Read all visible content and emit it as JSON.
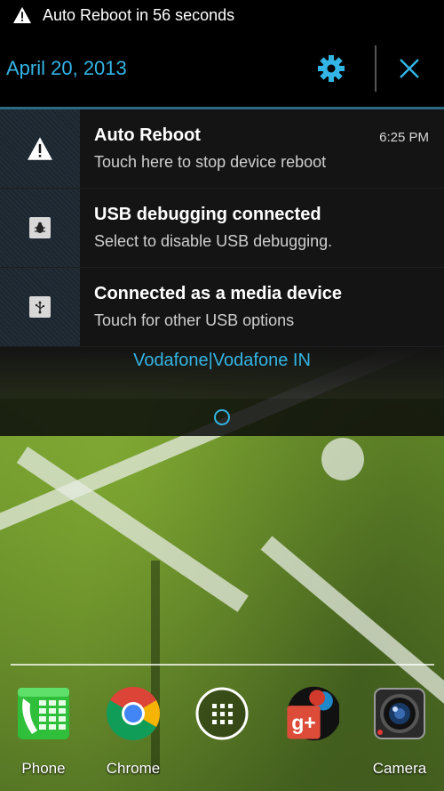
{
  "status_bar": {
    "ticker_text": "Auto Reboot in 56 seconds",
    "icon": "warning-icon"
  },
  "shade_header": {
    "date": "April 20, 2013",
    "settings_icon": "gear-icon",
    "clear_icon": "close-icon"
  },
  "notifications": [
    {
      "title": "Auto Reboot",
      "text": "Touch here to stop device reboot",
      "time": "6:25 PM",
      "icon": "warning-icon"
    },
    {
      "title": "USB debugging connected",
      "text": "Select to disable USB debugging.",
      "time": "",
      "icon": "bug-icon"
    },
    {
      "title": "Connected as a media device",
      "text": "Touch for other USB options",
      "time": "",
      "icon": "usb-icon"
    }
  ],
  "carrier": "Vodafone|Vodafone IN",
  "dock": [
    {
      "label": "Phone",
      "icon": "phone-icon"
    },
    {
      "label": "Chrome",
      "icon": "chrome-icon"
    },
    {
      "label": "",
      "icon": "app-drawer-icon"
    },
    {
      "label": "",
      "icon": "google-plus-icon"
    },
    {
      "label": "Camera",
      "icon": "camera-icon"
    }
  ],
  "colors": {
    "accent": "#33b5e5",
    "shade_background": "#141414",
    "status_bar": "#000000"
  }
}
